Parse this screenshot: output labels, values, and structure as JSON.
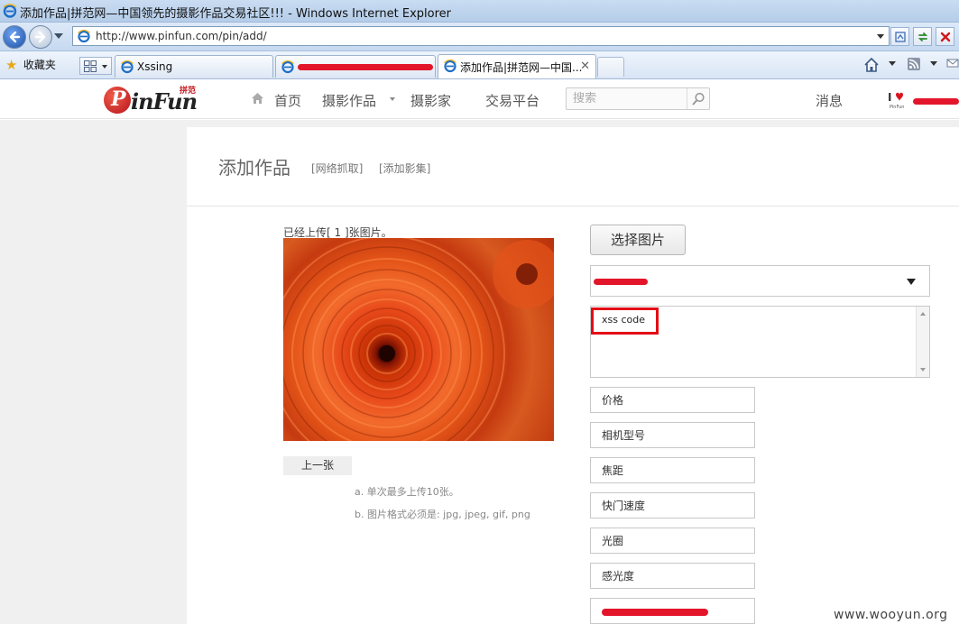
{
  "window": {
    "title": "添加作品|拼范网—中国领先的摄影作品交易社区!!! - Windows Internet Explorer"
  },
  "address_bar": {
    "url": "http://www.pinfun.com/pin/add/"
  },
  "favorites": {
    "label": "收藏夹"
  },
  "tabs": [
    {
      "label": "Xssing"
    },
    {
      "label": ""
    },
    {
      "label": "添加作品|拼范网—中国..."
    }
  ],
  "site": {
    "logo_text": "inFun",
    "logo_cn": "拼范",
    "nav": [
      {
        "label": "首页"
      },
      {
        "label": "摄影作品"
      },
      {
        "label": "摄影家"
      },
      {
        "label": "交易平台"
      }
    ],
    "search_placeholder": "搜索",
    "messages_label": "消息"
  },
  "page": {
    "title": "添加作品",
    "links": [
      {
        "label": "[网络抓取]"
      },
      {
        "label": "[添加影集]"
      }
    ],
    "upload_status": "已经上传[ 1 ]张图片。",
    "prev_button": "上一张",
    "hints": [
      "a.  单次最多上传10张。",
      "b.  图片格式必须是: jpg, jpeg, gif, png"
    ],
    "choose_button": "选择图片",
    "description_value": "xss code",
    "fields": [
      {
        "placeholder": "价格"
      },
      {
        "placeholder": "相机型号"
      },
      {
        "placeholder": "焦距"
      },
      {
        "placeholder": "快门速度"
      },
      {
        "placeholder": "光圈"
      },
      {
        "placeholder": "感光度"
      }
    ]
  },
  "watermark": "www.wooyun.org",
  "colors": {
    "brand_red": "#c3171e",
    "highlight_red": "#e30d16",
    "redaction_red": "#e3152a"
  }
}
